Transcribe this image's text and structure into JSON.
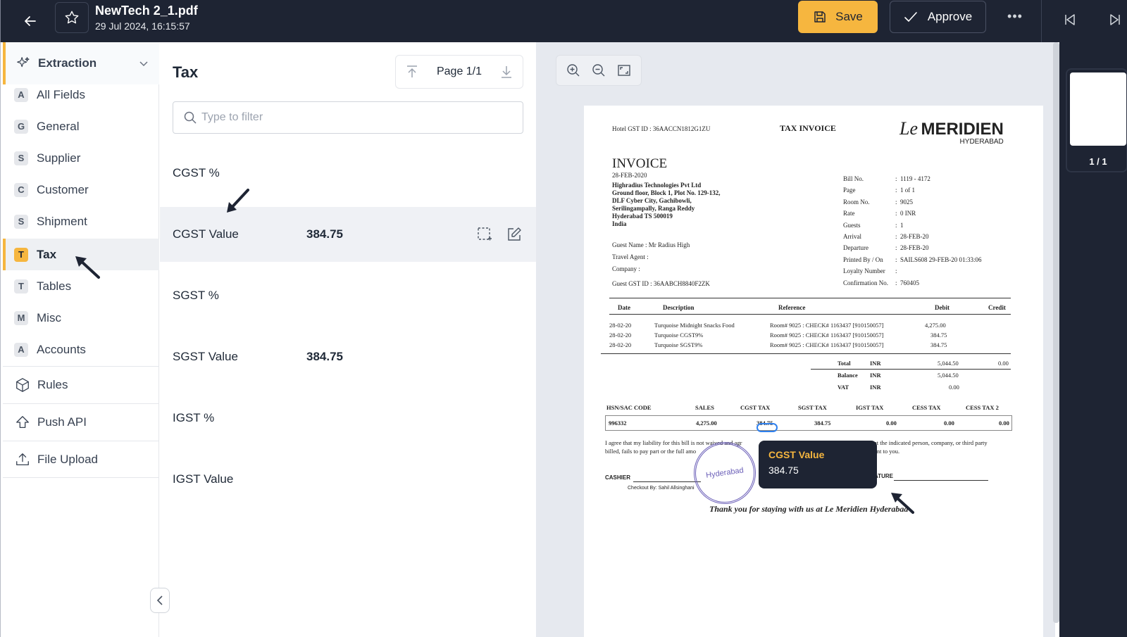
{
  "header": {
    "doc_title": "NewTech 2_1.pdf",
    "doc_date": "29 Jul 2024, 16:15:57",
    "save_label": "Save",
    "approve_label": "Approve",
    "more_label": "•••",
    "accent": "#f6b63f",
    "bg": "#1e2433"
  },
  "sidebar": {
    "section_label": "Extraction",
    "items": [
      {
        "badge": "A",
        "label": "All Fields"
      },
      {
        "badge": "G",
        "label": "General"
      },
      {
        "badge": "S",
        "label": "Supplier"
      },
      {
        "badge": "C",
        "label": "Customer"
      },
      {
        "badge": "S",
        "label": "Shipment"
      },
      {
        "badge": "T",
        "label": "Tax"
      },
      {
        "badge": "T",
        "label": "Tables"
      },
      {
        "badge": "M",
        "label": "Misc"
      },
      {
        "badge": "A",
        "label": "Accounts"
      }
    ],
    "active_item": "Tax",
    "actions": [
      {
        "label": "Rules",
        "icon": "cube-icon"
      },
      {
        "label": "Push API",
        "icon": "upload-house-icon"
      },
      {
        "label": "File Upload",
        "icon": "file-upload-icon"
      }
    ]
  },
  "fields_panel": {
    "title": "Tax",
    "page_label": "Page 1/1",
    "filter_placeholder": "Type to filter",
    "rows": [
      {
        "label": "CGST %",
        "value": ""
      },
      {
        "label": "CGST Value",
        "value": "384.75"
      },
      {
        "label": "SGST %",
        "value": ""
      },
      {
        "label": "SGST Value",
        "value": "384.75"
      },
      {
        "label": "IGST %",
        "value": ""
      },
      {
        "label": "IGST Value",
        "value": ""
      }
    ],
    "active_row": "CGST Value"
  },
  "viewer": {
    "thumbnail_label": "1 / 1",
    "tooltip": {
      "title": "CGST Value",
      "value": "384.75"
    },
    "invoice": {
      "hotel_gst": "Hotel GST ID   :  36AACCN1812G1ZU",
      "heading": "TAX INVOICE",
      "brand_script": "Le",
      "brand": "MERIDIEN",
      "brand_sub": "HYDERABAD",
      "invoice_title": "INVOICE",
      "invoice_date": "28-FEB-2020",
      "address": [
        "Highradius Technologies Pvt Ltd",
        "Ground floor, Block 1, Plot No. 129-132,",
        "DLF Cyber City, Gachibowli,",
        "Serilingampally, Ranga Reddy",
        "Hyderabad TS 500019",
        "India"
      ],
      "guest_info": [
        "Guest Name    :  Mr Radius High",
        "Travel Agent   :",
        "Company        :",
        "Guest GST ID   :  36AABCH8840F2ZK"
      ],
      "bill_info": [
        {
          "k": "Bill No.",
          "v": "1119    - 4172"
        },
        {
          "k": "Page",
          "v": "1 of  1"
        },
        {
          "k": "Room No.",
          "v": "9025"
        },
        {
          "k": "Rate",
          "v": "0                INR"
        },
        {
          "k": "Guests",
          "v": "1"
        },
        {
          "k": "Arrival",
          "v": "28-FEB-20"
        },
        {
          "k": "Departure",
          "v": "28-FEB-20"
        },
        {
          "k": "Printed By / On",
          "v": "SAILS608 29-FEB-20 01:33:06"
        },
        {
          "k": "Loyalty Number",
          "v": ""
        },
        {
          "k": "Confirmation No.",
          "v": "760405"
        }
      ],
      "table_headers": [
        "Date",
        "Description",
        "Reference",
        "Debit",
        "Credit"
      ],
      "table_rows": [
        {
          "date": "28-02-20",
          "desc": "Turquoise Midnight Snacks Food",
          "ref": "Room# 9025 : CHECK# 1163437 [910150057]",
          "debit": "4,275.00"
        },
        {
          "date": "28-02-20",
          "desc": "Turquoise CGST9%",
          "ref": "Room# 9025 : CHECK# 1163437 [910150057]",
          "debit": "384.75"
        },
        {
          "date": "28-02-20",
          "desc": "Turquoise SGST9%",
          "ref": "Room# 9025 : CHECK# 1163437 [910150057]",
          "debit": "384.75"
        }
      ],
      "totals": [
        {
          "label": "Total",
          "cur": "INR",
          "debit": "5,044.50",
          "credit": "0.00"
        },
        {
          "label": "Balance",
          "cur": "INR",
          "debit": "5,044.50",
          "credit": ""
        },
        {
          "label": "VAT",
          "cur": "INR",
          "debit": "0.00",
          "credit": ""
        }
      ],
      "tax_headers": [
        "HSN/SAC CODE",
        "SALES",
        "CGST TAX",
        "SGST TAX",
        "IGST TAX",
        "CESS TAX",
        "CESS TAX 2"
      ],
      "tax_values": [
        "996332",
        "4,275.00",
        "384.75",
        "384.75",
        "0.00",
        "0.00",
        "0.00"
      ],
      "agree_text_1": "I agree that my liability for this bill is not waived and agr",
      "agree_text_1b": "at the indicated person, company, or third party",
      "agree_text_2": "billed, fails to pay part or the full amo",
      "agree_text_2b": "ent to you.",
      "cashier": "CASHIER",
      "signature_tail": "ATURE",
      "checkout": "Checkout By:    Sahil Allsinghani",
      "stamp_text": "Hyderabad",
      "thank_you": "Thank you for staying with us at Le Meridien Hyderabad"
    }
  }
}
